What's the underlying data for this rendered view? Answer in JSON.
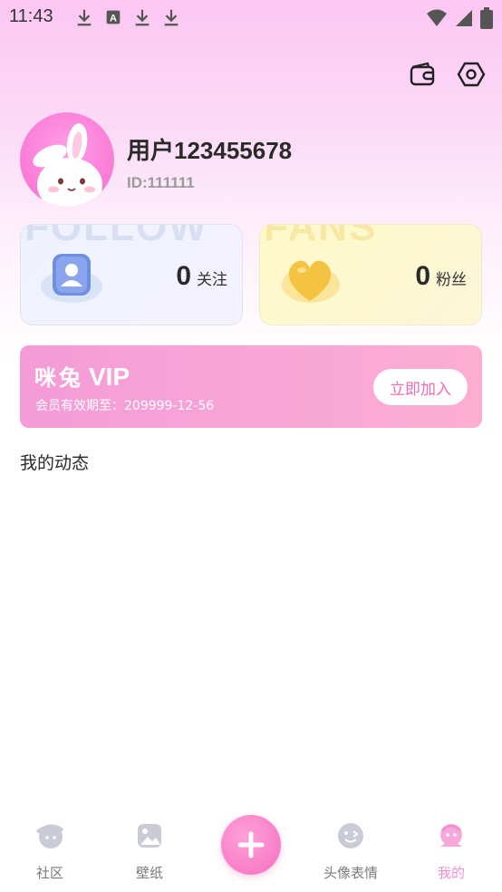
{
  "status_bar": {
    "time": "11:43",
    "icons_left": [
      "download-icon",
      "app-a-icon",
      "download-icon",
      "download-icon"
    ],
    "icons_right": [
      "wifi-icon",
      "signal-icon",
      "battery-icon"
    ]
  },
  "header": {
    "wallet_icon": "wallet-icon",
    "settings_icon": "settings-hexagon-icon"
  },
  "profile": {
    "username": "用户123455678",
    "user_id": "ID:111111",
    "avatar_icon": "bunny-avatar"
  },
  "stats": {
    "follow": {
      "watermark": "FOLLOW",
      "count": "0",
      "label": "关注",
      "icon": "user-badge-icon"
    },
    "fans": {
      "watermark": "FANS",
      "count": "0",
      "label": "粉丝",
      "icon": "heart-icon"
    }
  },
  "vip": {
    "title_cn": "咪兔",
    "title_en": "VIP",
    "expiry": "会员有效期至：209999-12-56",
    "join_label": "立即加入"
  },
  "feed": {
    "title": "我的动态"
  },
  "bottom_nav": {
    "items": [
      {
        "label": "社区",
        "icon": "community-icon"
      },
      {
        "label": "壁纸",
        "icon": "wallpaper-icon"
      },
      {
        "label": "",
        "icon": "plus-icon"
      },
      {
        "label": "头像表情",
        "icon": "face-emoji-icon"
      },
      {
        "label": "我的",
        "icon": "profile-icon"
      }
    ],
    "active_index": 4
  },
  "colors": {
    "accent_pink": "#f28fcf",
    "vip_button_text": "#ef6bb7",
    "nav_inactive": "#7a7a7a"
  }
}
